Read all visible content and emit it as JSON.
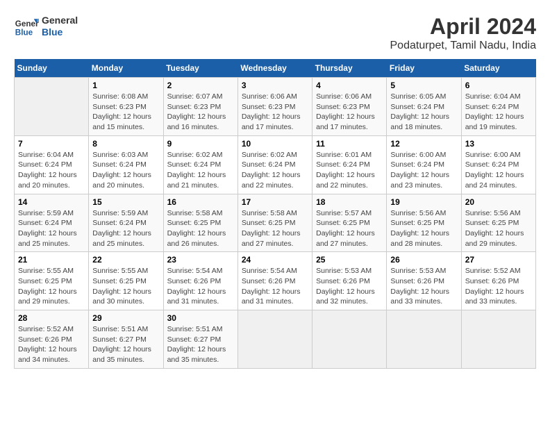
{
  "header": {
    "logo_line1": "General",
    "logo_line2": "Blue",
    "title": "April 2024",
    "subtitle": "Podaturpet, Tamil Nadu, India"
  },
  "calendar": {
    "days_of_week": [
      "Sunday",
      "Monday",
      "Tuesday",
      "Wednesday",
      "Thursday",
      "Friday",
      "Saturday"
    ],
    "weeks": [
      [
        {
          "day": "",
          "info": ""
        },
        {
          "day": "1",
          "info": "Sunrise: 6:08 AM\nSunset: 6:23 PM\nDaylight: 12 hours\nand 15 minutes."
        },
        {
          "day": "2",
          "info": "Sunrise: 6:07 AM\nSunset: 6:23 PM\nDaylight: 12 hours\nand 16 minutes."
        },
        {
          "day": "3",
          "info": "Sunrise: 6:06 AM\nSunset: 6:23 PM\nDaylight: 12 hours\nand 17 minutes."
        },
        {
          "day": "4",
          "info": "Sunrise: 6:06 AM\nSunset: 6:23 PM\nDaylight: 12 hours\nand 17 minutes."
        },
        {
          "day": "5",
          "info": "Sunrise: 6:05 AM\nSunset: 6:24 PM\nDaylight: 12 hours\nand 18 minutes."
        },
        {
          "day": "6",
          "info": "Sunrise: 6:04 AM\nSunset: 6:24 PM\nDaylight: 12 hours\nand 19 minutes."
        }
      ],
      [
        {
          "day": "7",
          "info": "Sunrise: 6:04 AM\nSunset: 6:24 PM\nDaylight: 12 hours\nand 20 minutes."
        },
        {
          "day": "8",
          "info": "Sunrise: 6:03 AM\nSunset: 6:24 PM\nDaylight: 12 hours\nand 20 minutes."
        },
        {
          "day": "9",
          "info": "Sunrise: 6:02 AM\nSunset: 6:24 PM\nDaylight: 12 hours\nand 21 minutes."
        },
        {
          "day": "10",
          "info": "Sunrise: 6:02 AM\nSunset: 6:24 PM\nDaylight: 12 hours\nand 22 minutes."
        },
        {
          "day": "11",
          "info": "Sunrise: 6:01 AM\nSunset: 6:24 PM\nDaylight: 12 hours\nand 22 minutes."
        },
        {
          "day": "12",
          "info": "Sunrise: 6:00 AM\nSunset: 6:24 PM\nDaylight: 12 hours\nand 23 minutes."
        },
        {
          "day": "13",
          "info": "Sunrise: 6:00 AM\nSunset: 6:24 PM\nDaylight: 12 hours\nand 24 minutes."
        }
      ],
      [
        {
          "day": "14",
          "info": "Sunrise: 5:59 AM\nSunset: 6:24 PM\nDaylight: 12 hours\nand 25 minutes."
        },
        {
          "day": "15",
          "info": "Sunrise: 5:59 AM\nSunset: 6:24 PM\nDaylight: 12 hours\nand 25 minutes."
        },
        {
          "day": "16",
          "info": "Sunrise: 5:58 AM\nSunset: 6:25 PM\nDaylight: 12 hours\nand 26 minutes."
        },
        {
          "day": "17",
          "info": "Sunrise: 5:58 AM\nSunset: 6:25 PM\nDaylight: 12 hours\nand 27 minutes."
        },
        {
          "day": "18",
          "info": "Sunrise: 5:57 AM\nSunset: 6:25 PM\nDaylight: 12 hours\nand 27 minutes."
        },
        {
          "day": "19",
          "info": "Sunrise: 5:56 AM\nSunset: 6:25 PM\nDaylight: 12 hours\nand 28 minutes."
        },
        {
          "day": "20",
          "info": "Sunrise: 5:56 AM\nSunset: 6:25 PM\nDaylight: 12 hours\nand 29 minutes."
        }
      ],
      [
        {
          "day": "21",
          "info": "Sunrise: 5:55 AM\nSunset: 6:25 PM\nDaylight: 12 hours\nand 29 minutes."
        },
        {
          "day": "22",
          "info": "Sunrise: 5:55 AM\nSunset: 6:25 PM\nDaylight: 12 hours\nand 30 minutes."
        },
        {
          "day": "23",
          "info": "Sunrise: 5:54 AM\nSunset: 6:26 PM\nDaylight: 12 hours\nand 31 minutes."
        },
        {
          "day": "24",
          "info": "Sunrise: 5:54 AM\nSunset: 6:26 PM\nDaylight: 12 hours\nand 31 minutes."
        },
        {
          "day": "25",
          "info": "Sunrise: 5:53 AM\nSunset: 6:26 PM\nDaylight: 12 hours\nand 32 minutes."
        },
        {
          "day": "26",
          "info": "Sunrise: 5:53 AM\nSunset: 6:26 PM\nDaylight: 12 hours\nand 33 minutes."
        },
        {
          "day": "27",
          "info": "Sunrise: 5:52 AM\nSunset: 6:26 PM\nDaylight: 12 hours\nand 33 minutes."
        }
      ],
      [
        {
          "day": "28",
          "info": "Sunrise: 5:52 AM\nSunset: 6:26 PM\nDaylight: 12 hours\nand 34 minutes."
        },
        {
          "day": "29",
          "info": "Sunrise: 5:51 AM\nSunset: 6:27 PM\nDaylight: 12 hours\nand 35 minutes."
        },
        {
          "day": "30",
          "info": "Sunrise: 5:51 AM\nSunset: 6:27 PM\nDaylight: 12 hours\nand 35 minutes."
        },
        {
          "day": "",
          "info": ""
        },
        {
          "day": "",
          "info": ""
        },
        {
          "day": "",
          "info": ""
        },
        {
          "day": "",
          "info": ""
        }
      ]
    ]
  }
}
